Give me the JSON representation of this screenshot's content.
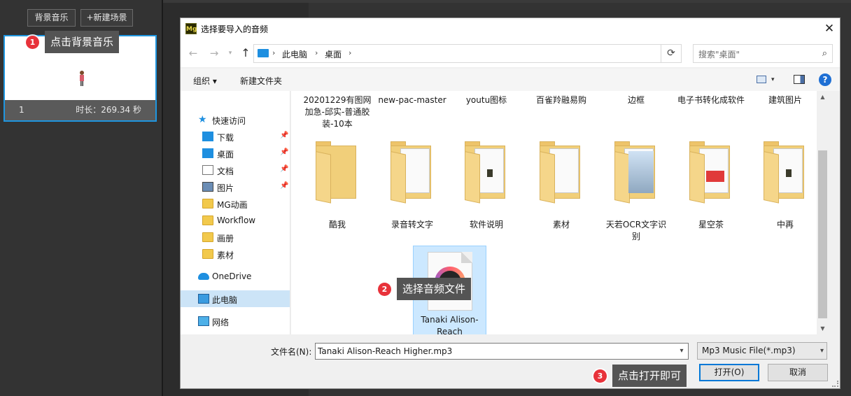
{
  "app": {
    "bgm_button": "背景音乐",
    "new_scene_button": "+新建场景",
    "scene": {
      "index": "1",
      "duration": "时长：269.34 秒"
    }
  },
  "callouts": [
    {
      "num": "1",
      "text": "点击背景音乐"
    },
    {
      "num": "2",
      "text": "选择音频文件"
    },
    {
      "num": "3",
      "text": "点击打开即可"
    }
  ],
  "dialog": {
    "title": "选择要导入的音频",
    "icon_text": "Mg",
    "close_glyph": "✕",
    "breadcrumb": [
      "此电脑",
      "桌面"
    ],
    "search_placeholder": "搜索\"桌面\"",
    "toolbar": {
      "organize": "组织 ▾",
      "new_folder": "新建文件夹"
    },
    "sidebar": [
      {
        "label": "快速访问",
        "icon": "star-icon"
      },
      {
        "label": "下载",
        "icon": "download-icon",
        "pinned": true
      },
      {
        "label": "桌面",
        "icon": "desktop-icon",
        "pinned": true
      },
      {
        "label": "文档",
        "icon": "document-icon",
        "pinned": true
      },
      {
        "label": "图片",
        "icon": "picture-icon",
        "pinned": true
      },
      {
        "label": "MG动画",
        "icon": "folder-icon"
      },
      {
        "label": "Workflow",
        "icon": "folder-icon"
      },
      {
        "label": "画册",
        "icon": "folder-icon"
      },
      {
        "label": "素材",
        "icon": "folder-icon"
      },
      {
        "label": "OneDrive",
        "icon": "cloud-icon"
      },
      {
        "label": "此电脑",
        "icon": "pc-icon",
        "selected": true
      },
      {
        "label": "网络",
        "icon": "network-icon"
      }
    ],
    "top_row": [
      "20201229有图网加急-邱实-普通胶装-10本",
      "new-pac-master",
      "youtu图标",
      "百雀羚融易购",
      "边框",
      "电子书转化成软件",
      "建筑图片"
    ],
    "folders": [
      "酷我",
      "录音转文字",
      "软件说明",
      "素材",
      "天若OCR文字识别",
      "星空茶",
      "中再"
    ],
    "selected_file": "Tanaki Alison-Reach Higher.mp3",
    "filename_label": "文件名(N):",
    "filename_value": "Tanaki Alison-Reach Higher.mp3",
    "filetype": "Mp3 Music File(*.mp3)",
    "open_button": "打开(O)",
    "cancel_button": "取消"
  },
  "colors": {
    "accent": "#0078d7",
    "callout_dot": "#e8323a",
    "selection": "#cce8ff"
  }
}
